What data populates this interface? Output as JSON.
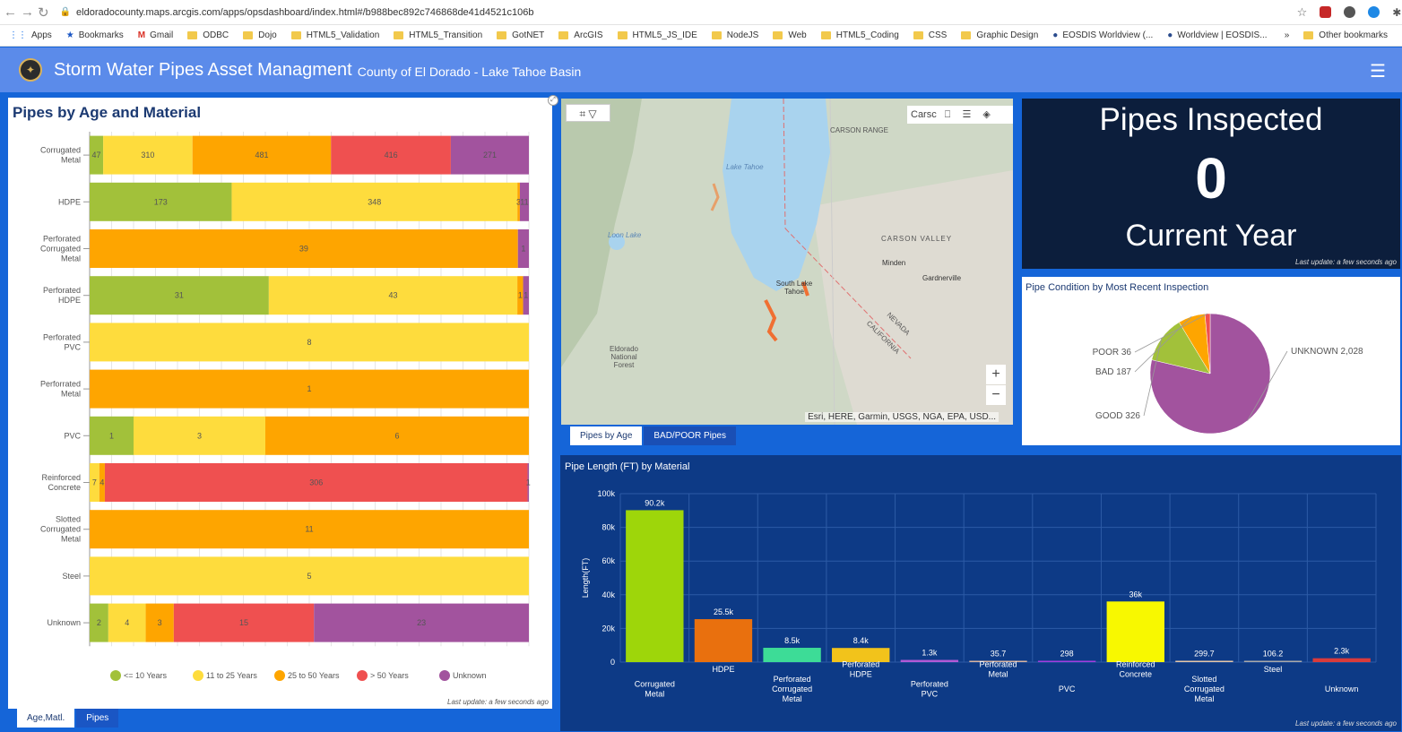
{
  "browser": {
    "url": "eldoradocounty.maps.arcgis.com/apps/opsdashboard/index.html#/b988bec892c746868de41d4521c106b",
    "bookmarks": [
      "Apps",
      "Bookmarks",
      "Gmail",
      "ODBC",
      "Dojo",
      "HTML5_Validation",
      "HTML5_Transition",
      "GotNET",
      "ArcGIS",
      "HTML5_JS_IDE",
      "NodeJS",
      "Web",
      "HTML5_Coding",
      "CSS",
      "Graphic Design",
      "EOSDIS Worldview (...",
      "Worldview | EOSDIS...",
      "Other bookmarks"
    ],
    "overflow": "»"
  },
  "header": {
    "title": "Storm Water Pipes Asset Managment",
    "subtitle": "County of El Dorado - Lake Tahoe Basin"
  },
  "left_panel": {
    "title": "Pipes by Age and Material",
    "last_update": "Last update: a few seconds ago",
    "tabs": [
      "Age,Matl.",
      "Pipes"
    ]
  },
  "map": {
    "attribution": "Esri, HERE, Garmin, USGS, NGA, EPA, USD...",
    "search_text": "Carsc",
    "labels": [
      "Lake Tahoe",
      "CARSON RANGE",
      "CARSON VALLEY",
      "Minden",
      "Gardnerville",
      "South Lake Tahoe",
      "Eldorado National Forest",
      "NEVADA",
      "CALIFORNIA",
      "Loon Lake"
    ],
    "zoom_in": "+",
    "zoom_out": "−",
    "tabs": [
      "Pipes by Age",
      "BAD/POOR Pipes"
    ]
  },
  "inspected": {
    "title": "Pipes Inspected",
    "value": "0",
    "subtitle": "Current Year",
    "last_update": "Last update: a few seconds ago"
  },
  "pie_panel": {
    "title": "Pipe Condition by Most Recent Inspection"
  },
  "bar_panel": {
    "title": "Pipe Length (FT) by Material",
    "last_update": "Last update: a few seconds ago"
  },
  "colors": {
    "age_le10": "#a2c13a",
    "age_11_25": "#fedc3d",
    "age_25_50": "#fea500",
    "age_gt50": "#ef5050",
    "age_unknown": "#a2539e",
    "bar_bg": "#0d3a86"
  },
  "chart_data": [
    {
      "type": "bar",
      "orientation": "horizontal",
      "stacked": "percent",
      "title": "Pipes by Age and Material",
      "categories": [
        "Corrugated Metal",
        "HDPE",
        "Perforated Corrugated Metal",
        "Perforated HDPE",
        "Perforated PVC",
        "Perforrated Metal",
        "PVC",
        "Reinforced Concrete",
        "Slotted Corrugated Metal",
        "Steel",
        "Unknown"
      ],
      "series": [
        {
          "name": "<= 10 Years",
          "color": "#a2c13a",
          "values": [
            47,
            173,
            0,
            31,
            0,
            0,
            1,
            0,
            0,
            0,
            2
          ]
        },
        {
          "name": "11 to 25 Years",
          "color": "#fedc3d",
          "values": [
            310,
            348,
            0,
            43,
            8,
            0,
            3,
            7,
            0,
            5,
            4
          ]
        },
        {
          "name": "25 to 50 Years",
          "color": "#fea500",
          "values": [
            481,
            3,
            39,
            1,
            0,
            1,
            6,
            4,
            11,
            0,
            3
          ]
        },
        {
          "name": "> 50 Years",
          "color": "#ef5050",
          "values": [
            416,
            0,
            0,
            0,
            0,
            0,
            0,
            306,
            0,
            0,
            15
          ]
        },
        {
          "name": "Unknown",
          "color": "#a2539e",
          "values": [
            271,
            11,
            1,
            1,
            0,
            0,
            0,
            1,
            0,
            0,
            23
          ]
        }
      ],
      "legend": "bottom"
    },
    {
      "type": "pie",
      "title": "Pipe Condition by Most Recent Inspection",
      "slices": [
        {
          "label": "UNKNOWN",
          "value": 2028,
          "display": "UNKNOWN 2,028",
          "color": "#a2539e"
        },
        {
          "label": "GOOD",
          "value": 326,
          "display": "GOOD 326",
          "color": "#a2c13a"
        },
        {
          "label": "BAD",
          "value": 187,
          "display": "BAD 187",
          "color": "#fea500"
        },
        {
          "label": "POOR",
          "value": 36,
          "display": "POOR 36",
          "color": "#ef5050"
        }
      ]
    },
    {
      "type": "bar",
      "title": "Pipe Length (FT) by Material",
      "ylabel": "Length(FT)",
      "ylim": [
        0,
        100000
      ],
      "yticks": [
        0,
        20000,
        40000,
        60000,
        80000,
        100000
      ],
      "ytick_labels": [
        "0",
        "20k",
        "40k",
        "60k",
        "80k",
        "100k"
      ],
      "categories": [
        "Corrugated Metal",
        "HDPE",
        "Perforated Corrugated Metal",
        "Perforated HDPE",
        "Perforated PVC",
        "Perforated Metal",
        "PVC",
        "Reinforced Concrete",
        "Slotted Corrugated Metal",
        "Steel",
        "Unknown"
      ],
      "values": [
        90200,
        25500,
        8500,
        8400,
        1300,
        35.7,
        298,
        36000,
        299.7,
        106.2,
        2300
      ],
      "value_labels": [
        "90.2k",
        "25.5k",
        "8.5k",
        "8.4k",
        "1.3k",
        "35.7",
        "298",
        "36k",
        "299.7",
        "106.2",
        "2.3k"
      ],
      "colors": [
        "#9ed60a",
        "#e9700e",
        "#3ddc97",
        "#f2c31b",
        "#b15ad6",
        "#d8b3a0",
        "#a33ee0",
        "#f8f800",
        "#e6c7a8",
        "#aaaaaa",
        "#d93b3b"
      ],
      "grid": true
    }
  ]
}
